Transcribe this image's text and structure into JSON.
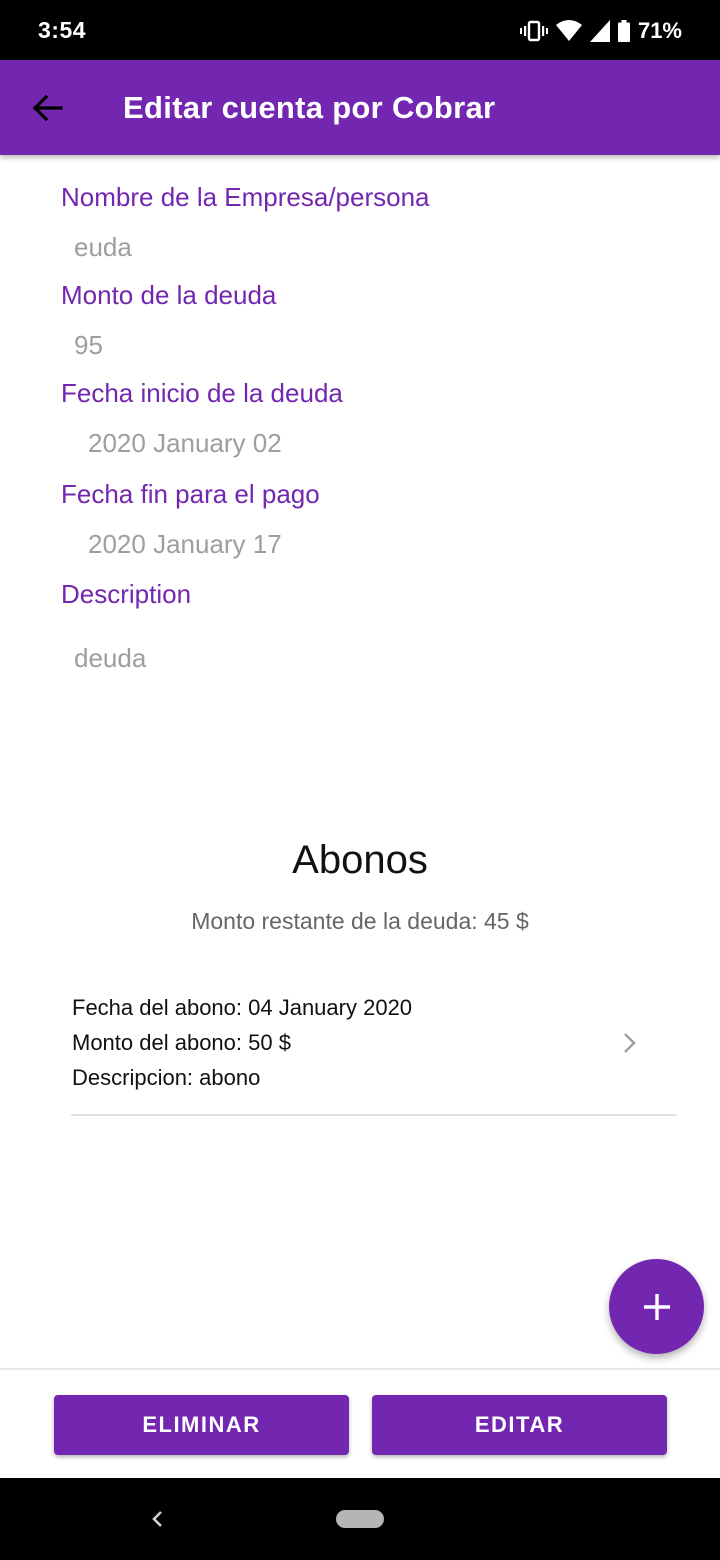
{
  "status_bar": {
    "time": "3:54",
    "battery": "71%"
  },
  "app_bar": {
    "title": "Editar cuenta por Cobrar"
  },
  "form": {
    "name_label": "Nombre de la Empresa/persona",
    "name_value": "euda",
    "amount_label": "Monto de la deuda",
    "amount_value": "95",
    "start_label": "Fecha inicio de la deuda",
    "start_value": "2020 January 02",
    "end_label": "Fecha fin para el pago",
    "end_value": "2020 January 17",
    "description_label": "Description",
    "description_value": "deuda"
  },
  "abonos": {
    "title": "Abonos",
    "remaining": "Monto restante de la deuda: 45 $",
    "items": [
      {
        "date": "Fecha del abono: 04 January 2020",
        "amount": "Monto del abono: 50 $",
        "description": "Descripcion: abono"
      }
    ]
  },
  "actions": {
    "delete_label": "ELIMINAR",
    "edit_label": "EDITAR"
  },
  "colors": {
    "primary": "#7327b0",
    "value_text": "#9e9e9e"
  },
  "icons": {
    "back": "arrow-left-icon",
    "add": "plus-icon",
    "chevron": "chevron-right-icon"
  }
}
